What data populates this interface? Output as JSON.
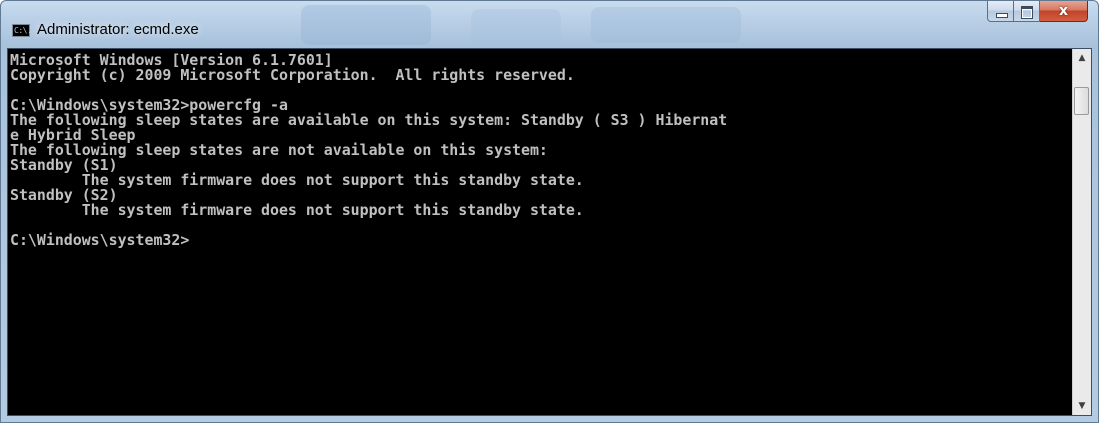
{
  "window": {
    "title": "Administrator: ecmd.exe",
    "icon_text": "C:\\.",
    "icon": "console-icon",
    "close_symbol": "x",
    "colors": {
      "console_bg": "#000000",
      "console_text": "#c0c0c0",
      "titlebar": "#b9cfe6",
      "close_button": "#c0442b"
    }
  },
  "console": {
    "lines": [
      "Microsoft Windows [Version 6.1.7601]",
      "Copyright (c) 2009 Microsoft Corporation.  All rights reserved.",
      "",
      "C:\\Windows\\system32>powercfg -a",
      "The following sleep states are available on this system: Standby ( S3 ) Hibernat",
      "e Hybrid Sleep",
      "The following sleep states are not available on this system:",
      "Standby (S1)",
      "        The system firmware does not support this standby state.",
      "Standby (S2)",
      "        The system firmware does not support this standby state.",
      "",
      "C:\\Windows\\system32>"
    ]
  },
  "scrollbar": {
    "up_arrow": "▲",
    "down_arrow": "▼"
  }
}
